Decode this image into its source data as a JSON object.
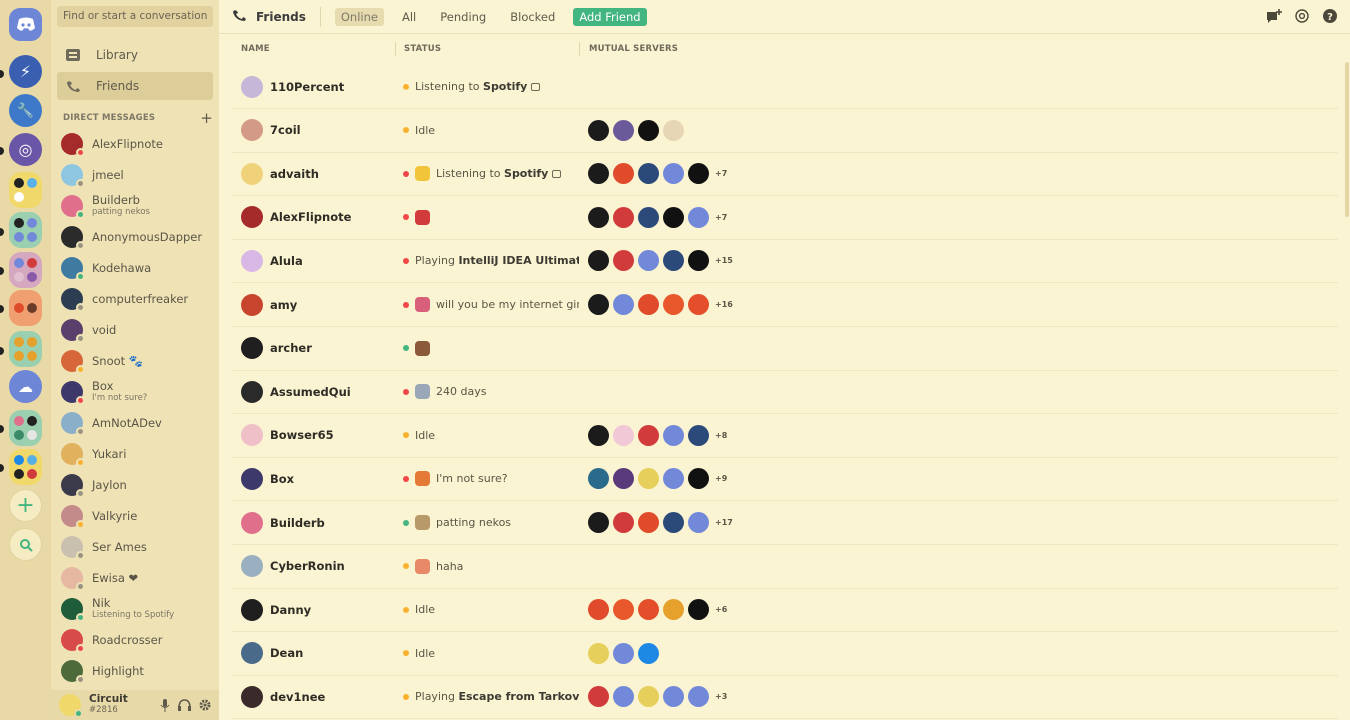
{
  "search": {
    "placeholder": "Find or start a conversation"
  },
  "nav": {
    "library": "Library",
    "friends": "Friends"
  },
  "dm_header": "DIRECT MESSAGES",
  "dms": [
    {
      "name": "AlexFlipnote",
      "sub": "",
      "color": "#a52a2a",
      "status": "dnd"
    },
    {
      "name": "jmeel",
      "sub": "",
      "color": "#8fc7e0",
      "status": "offline"
    },
    {
      "name": "Builderb",
      "sub": "patting nekos",
      "color": "#e06f8b",
      "status": "online"
    },
    {
      "name": "AnonymousDapper",
      "sub": "",
      "color": "#2b2b2b",
      "status": "offline"
    },
    {
      "name": "Kodehawa",
      "sub": "",
      "color": "#3f7aa0",
      "status": "online"
    },
    {
      "name": "computerfreaker",
      "sub": "",
      "color": "#2c3d52",
      "status": "offline"
    },
    {
      "name": "void",
      "sub": "",
      "color": "#5a3e6b",
      "status": "offline"
    },
    {
      "name": "Snoot 🐾",
      "sub": "",
      "color": "#d7673b",
      "status": "idle"
    },
    {
      "name": "Box",
      "sub": "I'm not sure?",
      "color": "#3d3a6b",
      "status": "dnd"
    },
    {
      "name": "AmNotADev",
      "sub": "",
      "color": "#8ab0c9",
      "status": "offline"
    },
    {
      "name": "Yukari",
      "sub": "",
      "color": "#e2b15e",
      "status": "idle"
    },
    {
      "name": "Jaylon",
      "sub": "",
      "color": "#3a3a4a",
      "status": "offline"
    },
    {
      "name": "Valkyrie",
      "sub": "",
      "color": "#c48b8b",
      "status": "idle"
    },
    {
      "name": "Ser Ames",
      "sub": "",
      "color": "#c9c0b0",
      "status": "offline"
    },
    {
      "name": "Ewisa ❤",
      "sub": "",
      "color": "#e6b8a2",
      "status": "offline"
    },
    {
      "name": "Nik",
      "sub": "Listening to Spotify",
      "color": "#1f5c3a",
      "status": "online"
    },
    {
      "name": "Roadcrosser",
      "sub": "",
      "color": "#d84b4b",
      "status": "dnd"
    },
    {
      "name": "Highlight",
      "sub": "",
      "color": "#4d6b3a",
      "status": "offline"
    }
  ],
  "user": {
    "name": "Circuit",
    "tag": "#2816"
  },
  "topbar": {
    "title": "Friends",
    "tab_online": "Online",
    "tab_all": "All",
    "tab_pending": "Pending",
    "tab_blocked": "Blocked",
    "tab_add": "Add Friend"
  },
  "columns": {
    "name": "NAME",
    "status": "STATUS",
    "mutual": "MUTUAL SERVERS"
  },
  "friends": [
    {
      "name": "110Percent",
      "dot": "idle",
      "emoji": "",
      "pre": "Listening to ",
      "bold": "Spotify",
      "rest": "",
      "badge": true,
      "color": "#c6b7d8",
      "mutual": [],
      "more": ""
    },
    {
      "name": "7coil",
      "dot": "idle",
      "emoji": "",
      "pre": "Idle",
      "bold": "",
      "rest": "",
      "badge": false,
      "color": "#d49a88",
      "mutual": [
        "#1b1b1b",
        "#6a5a9a",
        "#111111",
        "#e6d6b6"
      ],
      "more": ""
    },
    {
      "name": "advaith",
      "dot": "dnd",
      "emoji": "#f2c43a",
      "pre": "Listening to ",
      "bold": "Spotify",
      "rest": "",
      "badge": true,
      "color": "#f0d27a",
      "mutual": [
        "#1b1b1b",
        "#e04b2c",
        "#2b4a7a",
        "#7289da",
        "#111111"
      ],
      "more": "+7"
    },
    {
      "name": "AlexFlipnote",
      "dot": "dnd",
      "emoji": "#d23b3b",
      "pre": "",
      "bold": "",
      "rest": "",
      "badge": false,
      "color": "#a52a2a",
      "mutual": [
        "#1b1b1b",
        "#d23b3b",
        "#2b4a7a",
        "#111111",
        "#7289da"
      ],
      "more": "+7"
    },
    {
      "name": "Alula",
      "dot": "dnd",
      "emoji": "",
      "pre": "Playing ",
      "bold": "IntelliJ IDEA Ultimate",
      "rest": "",
      "badge": true,
      "color": "#d9b8e6",
      "mutual": [
        "#1b1b1b",
        "#d23b3b",
        "#7289da",
        "#2b4a7a",
        "#111111"
      ],
      "more": "+15"
    },
    {
      "name": "amy",
      "dot": "dnd",
      "emoji": "#d8607a",
      "pre": "will you be my internet girlfr...",
      "bold": "",
      "rest": "",
      "badge": false,
      "color": "#c8452d",
      "mutual": [
        "#1b1b1b",
        "#7289da",
        "#e04b2c",
        "#e8582c",
        "#e44e2a"
      ],
      "more": "+16"
    },
    {
      "name": "archer",
      "dot": "online",
      "emoji": "#8a5a3a",
      "pre": "",
      "bold": "",
      "rest": "",
      "badge": false,
      "color": "#1f1f1f",
      "mutual": [],
      "more": ""
    },
    {
      "name": "AssumedQui",
      "dot": "dnd",
      "emoji": "#9aa7b8",
      "pre": "240 days",
      "bold": "",
      "rest": "",
      "badge": false,
      "color": "#2a2a2a",
      "mutual": [],
      "more": ""
    },
    {
      "name": "Bowser65",
      "dot": "idle",
      "emoji": "",
      "pre": "Idle",
      "bold": "",
      "rest": "",
      "badge": false,
      "color": "#efc0c8",
      "mutual": [
        "#1b1b1b",
        "#f0c8d6",
        "#d23b3b",
        "#7289da",
        "#2b4a7a"
      ],
      "more": "+8"
    },
    {
      "name": "Box",
      "dot": "dnd",
      "emoji": "#e57a36",
      "pre": "I'm not sure?",
      "bold": "",
      "rest": "",
      "badge": false,
      "color": "#3d3a6b",
      "mutual": [
        "#2a6a8a",
        "#5a3a7a",
        "#e6cf5a",
        "#7289da",
        "#111111"
      ],
      "more": "+9"
    },
    {
      "name": "Builderb",
      "dot": "online",
      "emoji": "#b89a6a",
      "pre": "patting nekos",
      "bold": "",
      "rest": "",
      "badge": false,
      "color": "#e06f8b",
      "mutual": [
        "#1b1b1b",
        "#d23b3b",
        "#e04b2c",
        "#2b4a7a",
        "#7289da"
      ],
      "more": "+17"
    },
    {
      "name": "CyberRonin",
      "dot": "idle",
      "emoji": "#e88a6a",
      "pre": "haha",
      "bold": "",
      "rest": "",
      "badge": false,
      "color": "#9ab0c0",
      "mutual": [],
      "more": ""
    },
    {
      "name": "Danny",
      "dot": "idle",
      "emoji": "",
      "pre": "Idle",
      "bold": "",
      "rest": "",
      "badge": false,
      "color": "#1f1f1f",
      "mutual": [
        "#e04b2c",
        "#e8582c",
        "#e44e2a",
        "#e6a02c",
        "#111111"
      ],
      "more": "+6"
    },
    {
      "name": "Dean",
      "dot": "idle",
      "emoji": "",
      "pre": "Idle",
      "bold": "",
      "rest": "",
      "badge": false,
      "color": "#4a6a8a",
      "mutual": [
        "#e6cf5a",
        "#7289da",
        "#1e88e5"
      ],
      "more": ""
    },
    {
      "name": "dev1nee",
      "dot": "idle",
      "emoji": "",
      "pre": "Playing ",
      "bold": "Escape from Tarkov",
      "rest": "",
      "badge": false,
      "color": "#3a2a2a",
      "mutual": [
        "#d23b3b",
        "#7289da",
        "#e6cf5a",
        "#7289da",
        "#7289da"
      ],
      "more": "+3"
    }
  ],
  "servers": [
    {
      "color": "#6e86d6"
    },
    {
      "color": "#6e86d6"
    },
    {
      "color": "#6e86d6"
    },
    {
      "color": "#6e86d6"
    }
  ]
}
